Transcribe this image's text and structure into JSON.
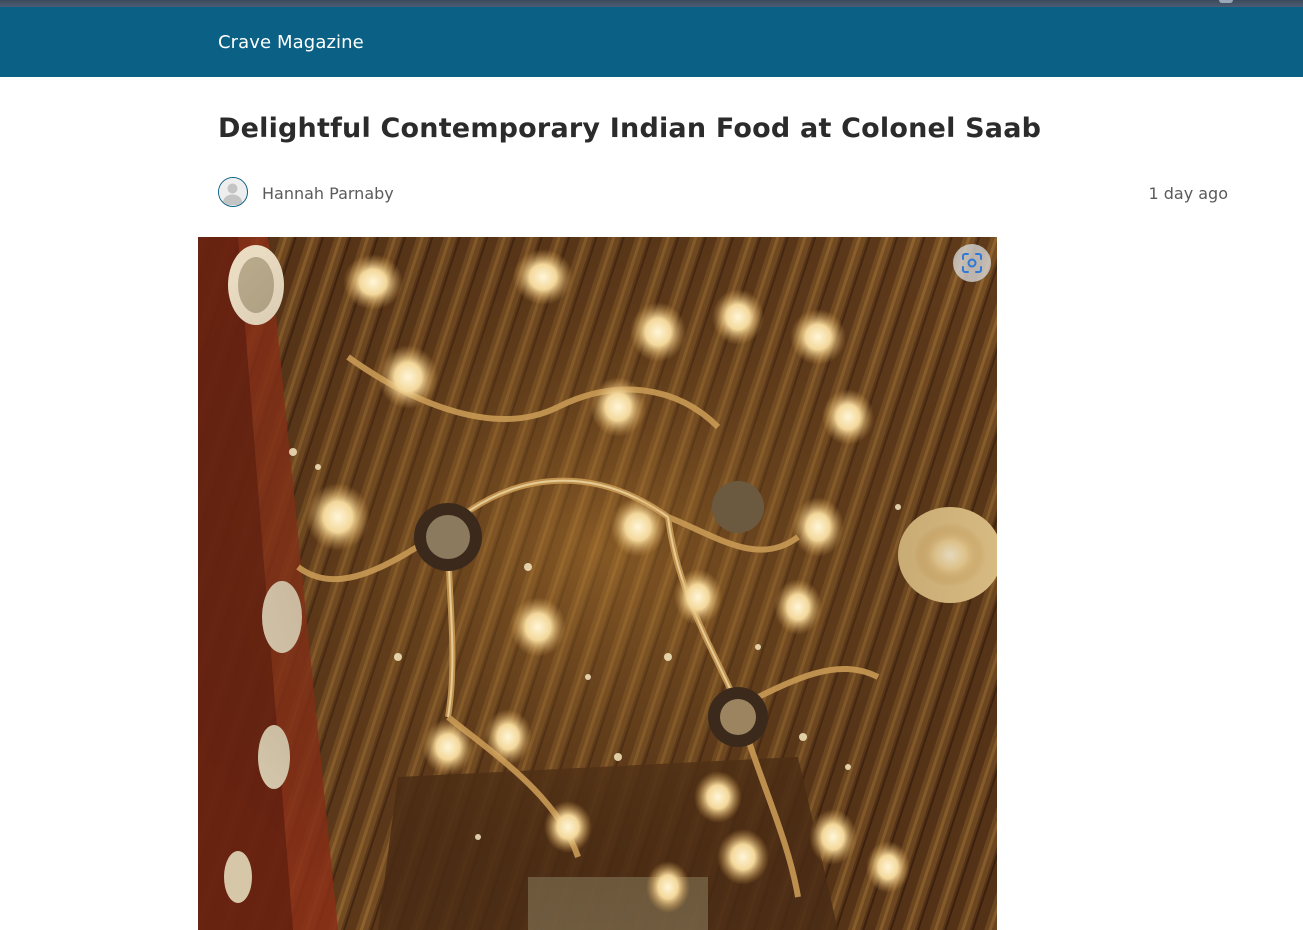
{
  "header": {
    "site_title": "Crave Magazine"
  },
  "article": {
    "title": "Delightful Contemporary Indian Food at Colonel Saab",
    "author": "Hannah Parnaby",
    "published": "1 day ago",
    "hero_image": {
      "description_icon": "chandelier-photo",
      "overlay_button_icon": "visual-search-icon"
    }
  },
  "colors": {
    "header_bg": "#0b6185",
    "title_text": "#2b2b2b",
    "meta_text": "#5a5a5a",
    "background": "#ffffff"
  }
}
